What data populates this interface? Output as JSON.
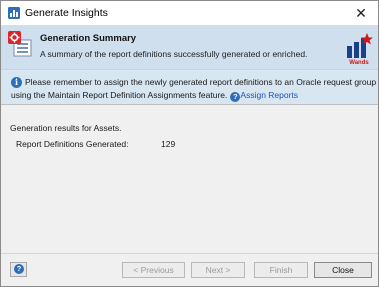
{
  "window": {
    "title": "Generate Insights",
    "close_glyph": "✕"
  },
  "header": {
    "title": "Generation Summary",
    "subtitle": "A summary of the report definitions successfully generated or enriched.",
    "brand": "Wands"
  },
  "info": {
    "line1": "Please remember to assign the newly generated report definitions to an Oracle request group",
    "line2": "using the Maintain Report Definition Assignments feature.",
    "link_label": "Assign Reports",
    "icon": "info-icon"
  },
  "results": {
    "heading": "Generation results for Assets.",
    "rows": [
      {
        "label": "Report Definitions Generated:",
        "value": "129"
      }
    ]
  },
  "footer": {
    "prev_label": "< Previous",
    "next_label": "Next >",
    "finish_label": "Finish",
    "close_label": "Close"
  },
  "colors": {
    "header_bg": "#cfdfee",
    "info_bg": "#d8e6f2",
    "accent": "#2c6fb8",
    "brand": "#d01818"
  }
}
